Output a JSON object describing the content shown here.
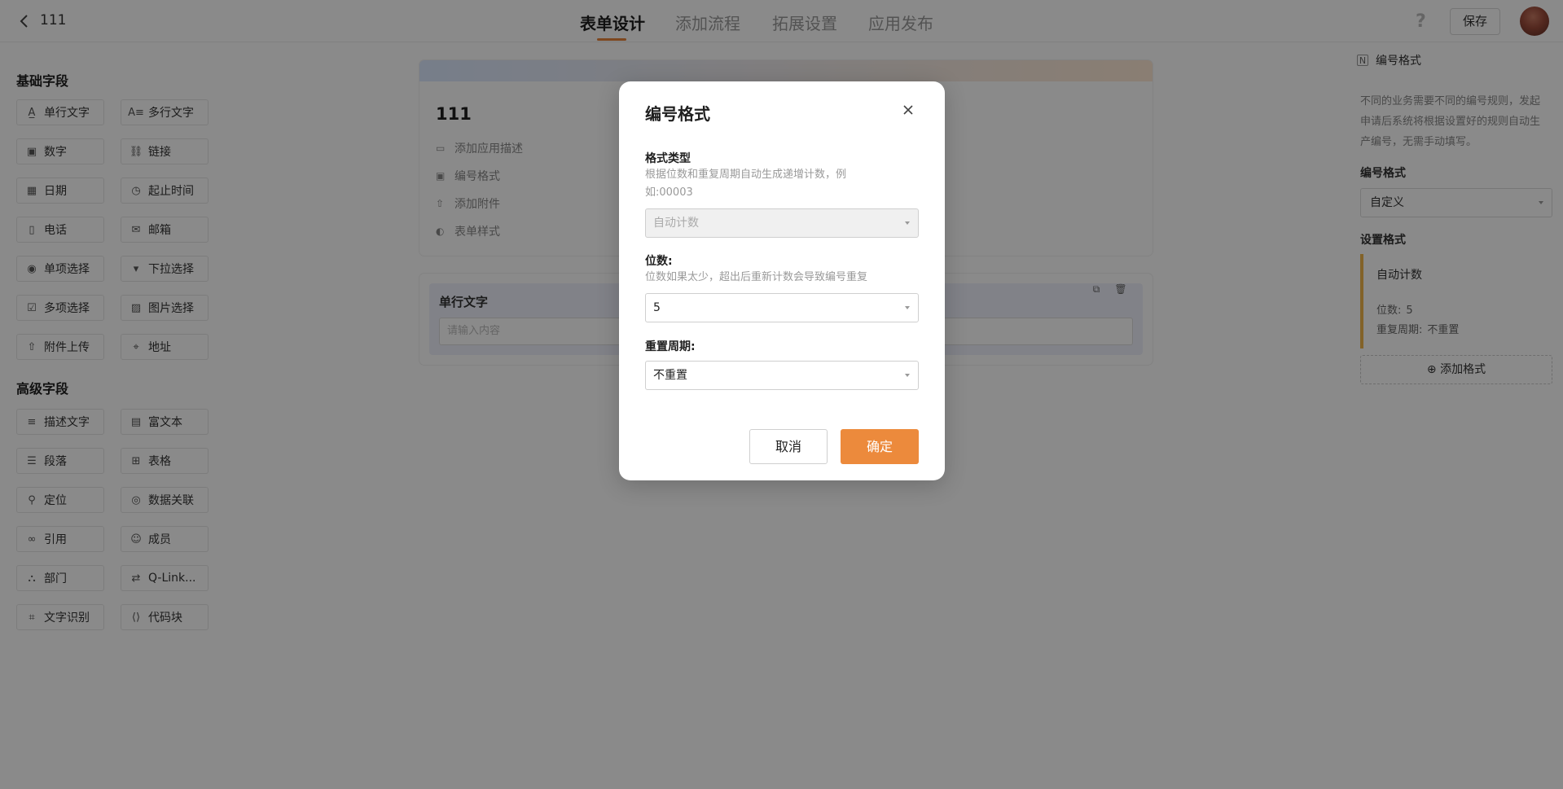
{
  "header": {
    "app_name": "111",
    "tabs": [
      {
        "label": "表单设计",
        "active": true
      },
      {
        "label": "添加流程",
        "active": false
      },
      {
        "label": "拓展设置",
        "active": false
      },
      {
        "label": "应用发布",
        "active": false
      }
    ],
    "help_icon": "question-icon",
    "save_label": "保存",
    "accent_color": "#e8833a"
  },
  "palette": {
    "basic_title": "基础字段",
    "basic_fields": [
      {
        "label": "单行文字",
        "icon": "text-line-icon"
      },
      {
        "label": "多行文字",
        "icon": "text-multiline-icon"
      },
      {
        "label": "数字",
        "icon": "number-icon"
      },
      {
        "label": "链接",
        "icon": "link-icon"
      },
      {
        "label": "日期",
        "icon": "calendar-icon"
      },
      {
        "label": "起止时间",
        "icon": "time-range-icon"
      },
      {
        "label": "电话",
        "icon": "phone-icon"
      },
      {
        "label": "邮箱",
        "icon": "mail-icon"
      },
      {
        "label": "单项选择",
        "icon": "radio-icon"
      },
      {
        "label": "下拉选择",
        "icon": "dropdown-icon"
      },
      {
        "label": "多项选择",
        "icon": "checkbox-icon"
      },
      {
        "label": "图片选择",
        "icon": "image-icon"
      },
      {
        "label": "附件上传",
        "icon": "upload-icon"
      },
      {
        "label": "地址",
        "icon": "location-icon"
      }
    ],
    "advanced_title": "高级字段",
    "advanced_fields": [
      {
        "label": "描述文字",
        "icon": "description-icon"
      },
      {
        "label": "富文本",
        "icon": "rich-text-icon"
      },
      {
        "label": "段落",
        "icon": "paragraph-icon"
      },
      {
        "label": "表格",
        "icon": "table-icon"
      },
      {
        "label": "定位",
        "icon": "pin-icon"
      },
      {
        "label": "数据关联",
        "icon": "data-link-icon"
      },
      {
        "label": "引用",
        "icon": "reference-icon"
      },
      {
        "label": "成员",
        "icon": "user-icon"
      },
      {
        "label": "部门",
        "icon": "department-icon"
      },
      {
        "label": "Q-Link...",
        "icon": "q-link-icon"
      },
      {
        "label": "文字识别",
        "icon": "ocr-icon"
      },
      {
        "label": "代码块",
        "icon": "code-icon"
      }
    ]
  },
  "canvas": {
    "form_title": "111",
    "links": [
      {
        "label": "添加应用描述",
        "icon": "comment-icon"
      },
      {
        "label": "编号格式",
        "icon": "number-icon"
      },
      {
        "label": "添加附件",
        "icon": "upload-icon"
      },
      {
        "label": "表单样式",
        "icon": "palette-icon"
      }
    ],
    "field": {
      "label": "单行文字",
      "placeholder": "请输入内容"
    }
  },
  "right_panel": {
    "title": "编号格式",
    "description": "不同的业务需要不同的编号规则，发起申请后系统将根据设置好的规则自动生产编号，无需手动填写。",
    "format_label": "编号格式",
    "format_value": "自定义",
    "setting_label": "设置格式",
    "rule": {
      "name": "自动计数",
      "digits_key": "位数:",
      "digits_value": "5",
      "period_key": "重复周期:",
      "period_value": "不重置"
    },
    "add_label": "添加格式"
  },
  "modal": {
    "title": "编号格式",
    "type_label": "格式类型",
    "type_hint": "根据位数和重复周期自动生成递增计数，例如:00003",
    "type_value": "自动计数",
    "digits_label": "位数:",
    "digits_hint": "位数如果太少，超出后重新计数会导致编号重复",
    "digits_value": "5",
    "period_label": "重置周期:",
    "period_value": "不重置",
    "cancel_label": "取消",
    "confirm_label": "确定",
    "confirm_color": "#ec8a3c"
  }
}
